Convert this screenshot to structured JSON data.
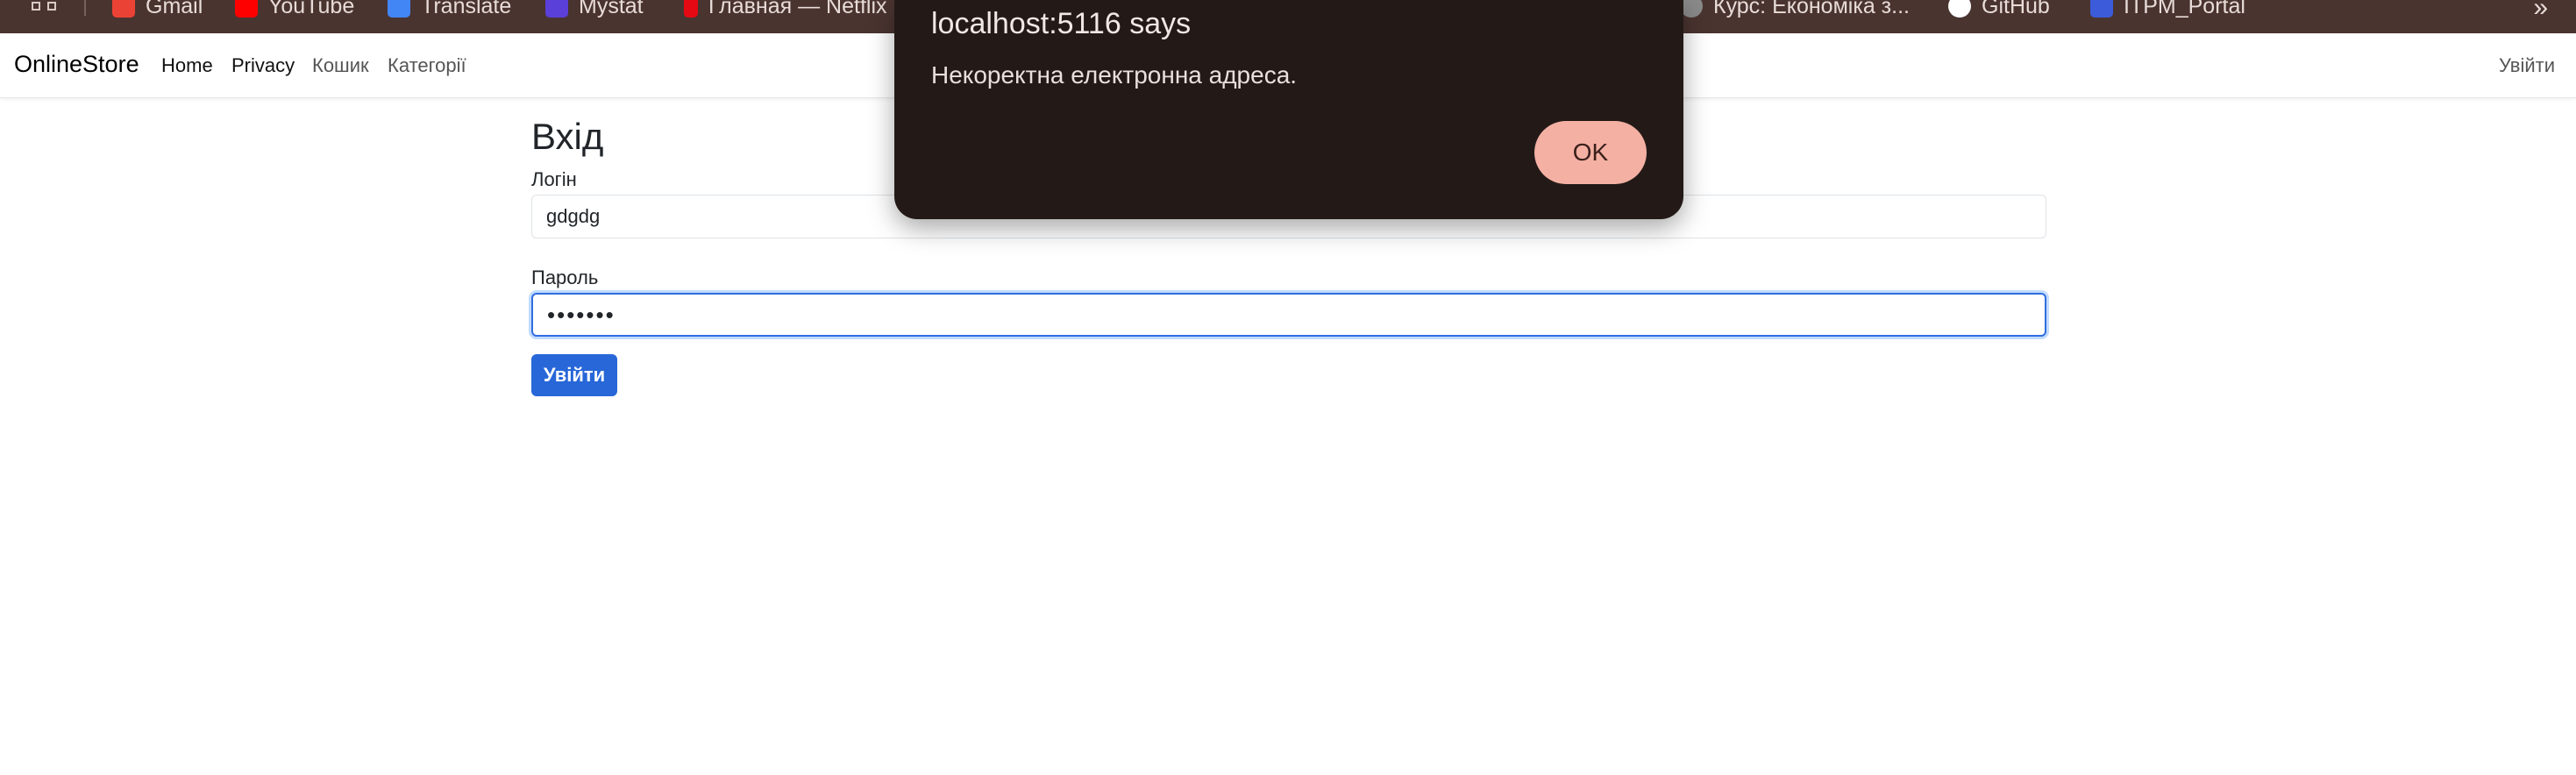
{
  "bookmarks": {
    "items": [
      {
        "label": "Gmail",
        "color": "#ea4335"
      },
      {
        "label": "YouTube",
        "color": "#ff0000"
      },
      {
        "label": "Translate",
        "color": "#4285f4"
      },
      {
        "label": "Mystat",
        "color": "#5b3fd9"
      },
      {
        "label": "Главная — Netflix",
        "color": "#e50914"
      },
      {
        "label": "Курс: Економіка з...",
        "color": "#8a8a8a"
      },
      {
        "label": "GitHub",
        "color": "#ffffff"
      },
      {
        "label": "ITPM_Portal",
        "color": "#3b5bdb"
      }
    ],
    "overflow_label": "»"
  },
  "navbar": {
    "brand": "OnlineStore",
    "links": [
      "Home",
      "Privacy",
      "Кошик",
      "Категорії"
    ],
    "login": "Увійти"
  },
  "form": {
    "title": "Вхід",
    "login_label": "Логін",
    "login_value": "gdgdg",
    "password_label": "Пароль",
    "password_value": "•••••••",
    "submit_label": "Увійти"
  },
  "dialog": {
    "title": "localhost:5116 says",
    "message": "Некоректна електронна адреса.",
    "ok_label": "OK"
  },
  "colors": {
    "primary": "#2767d8",
    "dialog_bg": "#231a17",
    "ok_button": "#f3b0a3",
    "bookmarks_bg": "#4a3430"
  }
}
